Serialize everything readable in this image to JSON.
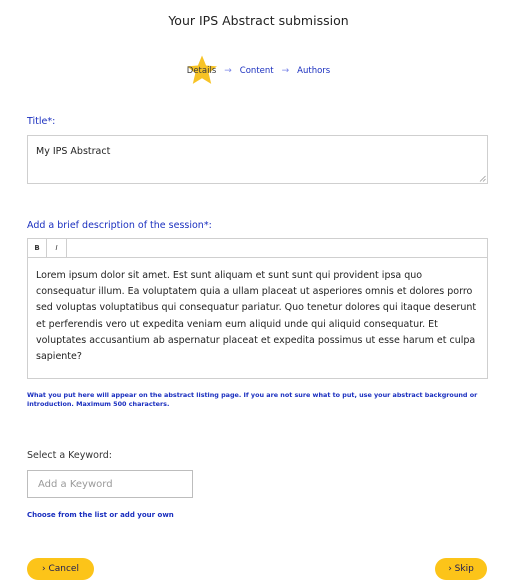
{
  "page": {
    "title": "Your IPS Abstract submission"
  },
  "steps": {
    "items": [
      {
        "label": "Details",
        "active": true
      },
      {
        "label": "Content",
        "active": false
      },
      {
        "label": "Authors",
        "active": false
      }
    ],
    "separator": "→"
  },
  "title_field": {
    "label": "Title*:",
    "value": "My IPS Abstract"
  },
  "description": {
    "label": "Add a brief description of the session*:",
    "toolbar": {
      "bold": "B",
      "italic": "I"
    },
    "value": "Lorem ipsum dolor sit amet. Est sunt aliquam et sunt sunt qui provident ipsa quo consequatur illum. Ea voluptatem quia a ullam placeat ut asperiores omnis et dolores porro sed voluptas voluptatibus qui consequatur pariatur. Quo tenetur dolores qui itaque deserunt et perferendis vero ut expedita veniam eum aliquid unde qui aliquid consequatur. Et voluptates accusantium ab aspernatur placeat et expedita possimus ut esse harum et culpa sapiente?",
    "help": "What you put here will appear on the abstract listing page. If you are not sure what to put, use your abstract background or introduction. Maximum 500 characters."
  },
  "keyword": {
    "label": "Select a Keyword:",
    "placeholder": "Add a Keyword",
    "hint": "Choose from the list or add your own"
  },
  "buttons": {
    "cancel": "› Cancel",
    "skip": "› Skip"
  },
  "colors": {
    "accent_blue": "#1a2fbf",
    "button_yellow": "#fcc419",
    "star_yellow": "#f7c325"
  }
}
